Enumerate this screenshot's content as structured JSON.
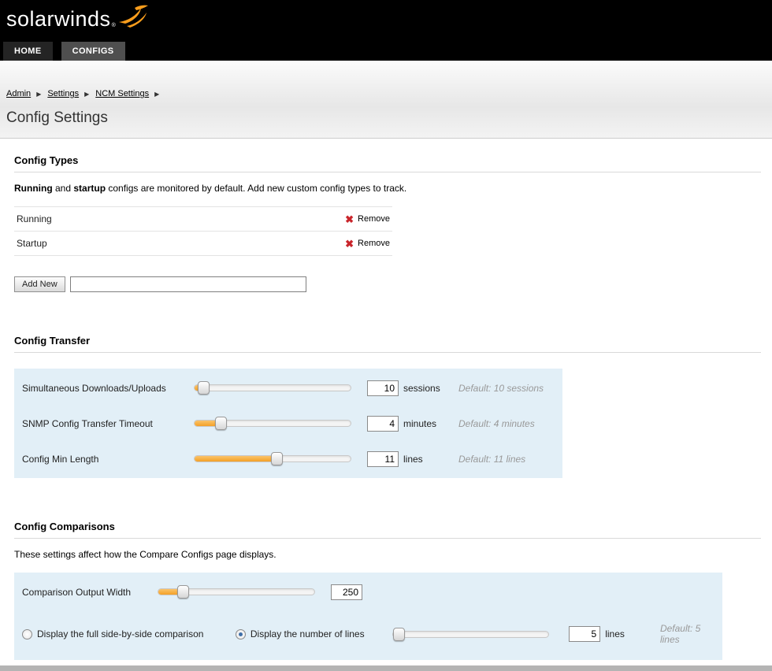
{
  "colors": {
    "accent_orange": "#f99d1c",
    "slider_fill": "#f4a127",
    "panel_blue": "#e2eff7",
    "remove_red": "#c9252b"
  },
  "icons": {
    "breadcrumb_arrow": "▶",
    "remove_x": "✖"
  },
  "header": {
    "logo_text": "solarwinds",
    "logo_mark": "®",
    "tabs": [
      {
        "label": "HOME"
      },
      {
        "label": "CONFIGS"
      }
    ]
  },
  "breadcrumb": {
    "items": [
      "Admin",
      "Settings",
      "NCM Settings"
    ]
  },
  "page": {
    "title": "Config Settings"
  },
  "config_types": {
    "heading": "Config Types",
    "desc": {
      "bold1": "Running",
      "mid": " and ",
      "bold2": "startup",
      "rest": " configs are monitored by default. Add new custom config types to track."
    },
    "rows": [
      {
        "name": "Running",
        "remove_label": "Remove"
      },
      {
        "name": "Startup",
        "remove_label": "Remove"
      }
    ],
    "add_button": "Add New",
    "new_type_value": ""
  },
  "config_transfer": {
    "heading": "Config Transfer",
    "rows": [
      {
        "label": "Simultaneous Downloads/Uploads",
        "value": "10",
        "unit": "sessions",
        "default": "Default: 10 sessions",
        "slider_pct": 6
      },
      {
        "label": "SNMP Config Transfer Timeout",
        "value": "4",
        "unit": "minutes",
        "default": "Default: 4 minutes",
        "slider_pct": 17
      },
      {
        "label": "Config Min Length",
        "value": "11",
        "unit": "lines",
        "default": "Default: 11 lines",
        "slider_pct": 53
      }
    ]
  },
  "config_comparisons": {
    "heading": "Config Comparisons",
    "desc": "These settings affect how the Compare Configs page displays.",
    "width_row": {
      "label": "Comparison Output Width",
      "value": "250",
      "slider_pct": 16
    },
    "display_options": [
      {
        "label": "Display the full side-by-side comparison",
        "selected": false
      },
      {
        "label": "Display the number of lines",
        "selected": true
      }
    ],
    "lines_row": {
      "value": "5",
      "unit": "lines",
      "default": "Default: 5 lines",
      "slider_pct": 4
    }
  }
}
